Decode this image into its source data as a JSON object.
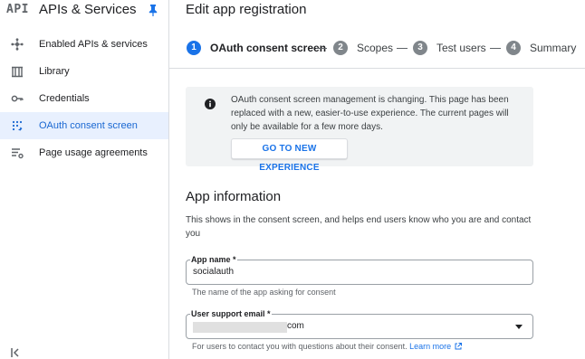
{
  "sidebar": {
    "logo": "API",
    "title": "APIs & Services",
    "items": [
      {
        "label": "Enabled APIs & services",
        "icon": "hub-icon"
      },
      {
        "label": "Library",
        "icon": "library-icon"
      },
      {
        "label": "Credentials",
        "icon": "key-icon"
      },
      {
        "label": "OAuth consent screen",
        "icon": "consent-icon",
        "active": true
      },
      {
        "label": "Page usage agreements",
        "icon": "settings-list-icon"
      }
    ]
  },
  "header": {
    "title": "Edit app registration"
  },
  "stepper": {
    "steps": [
      {
        "num": "1",
        "label": "OAuth consent screen",
        "active": true
      },
      {
        "num": "2",
        "label": "Scopes"
      },
      {
        "num": "3",
        "label": "Test users"
      },
      {
        "num": "4",
        "label": "Summary"
      }
    ]
  },
  "notice": {
    "text": "OAuth consent screen management is changing. This page has been replaced with a new, easier-to-use experience. The current pages will only be available for a few more days.",
    "button_label": "GO TO NEW EXPERIENCE"
  },
  "app_info": {
    "title": "App information",
    "description": "This shows in the consent screen, and helps end users know who you are and contact you",
    "app_name": {
      "label": "App name *",
      "value": "socialauth",
      "hint": "The name of the app asking for consent"
    },
    "support_email": {
      "label": "User support email *",
      "value_suffix": "com",
      "hint": "For users to contact you with questions about their consent.",
      "link": "Learn more"
    }
  },
  "colors": {
    "accent": "#1a73e8",
    "active_bg": "#e8f0fe",
    "notice_bg": "#f1f3f4"
  }
}
